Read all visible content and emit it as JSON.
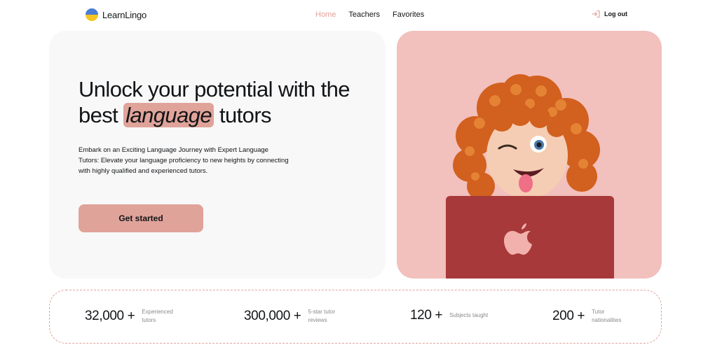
{
  "brand": {
    "name": "LearnLingo"
  },
  "nav": {
    "items": [
      {
        "label": "Home",
        "active": true
      },
      {
        "label": "Teachers",
        "active": false
      },
      {
        "label": "Favorites",
        "active": false
      }
    ]
  },
  "auth": {
    "logout_label": "Log out"
  },
  "hero": {
    "title_before": "Unlock your potential with the best ",
    "title_highlight": "language",
    "title_after": " tutors",
    "description": "Embark on an Exciting Language Journey with Expert Language Tutors: Elevate your language proficiency to new heights by connecting with highly qualified and experienced tutors.",
    "cta_label": "Get started"
  },
  "stats": [
    {
      "value": "32,000 +",
      "label": "Experienced tutors"
    },
    {
      "value": "300,000 +",
      "label": "5-star tutor reviews"
    },
    {
      "value": "120 +",
      "label": "Subjects taught"
    },
    {
      "value": "200 +",
      "label": "Tutor nationalities"
    }
  ],
  "colors": {
    "accent": "#e0a39a",
    "card_bg": "#f8f8f8",
    "image_bg": "#f2c0bd",
    "laptop": "#a8393a",
    "text": "#121417",
    "muted": "#8a8a89"
  },
  "icons": {
    "logo": "ukraine-flag-icon",
    "logout": "logout-icon",
    "laptop_logo": "apple-icon"
  }
}
